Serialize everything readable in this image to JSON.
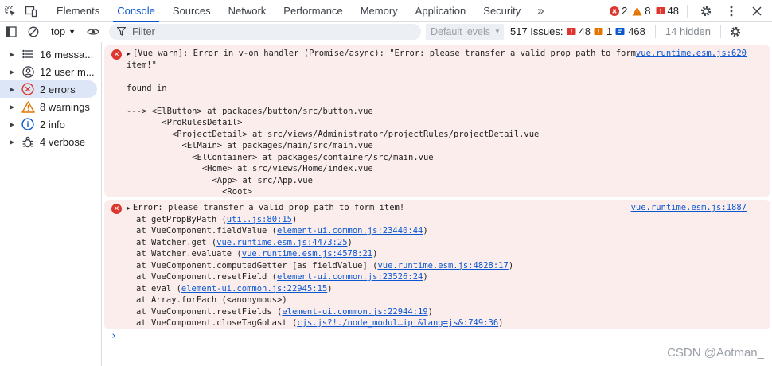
{
  "tabs": [
    "Elements",
    "Console",
    "Sources",
    "Network",
    "Performance",
    "Memory",
    "Application",
    "Security"
  ],
  "tab_counts": {
    "errors": "2",
    "warnings": "8",
    "issues": "48"
  },
  "toolbar": {
    "context": "top",
    "filter_placeholder": "Filter",
    "levels": "Default levels",
    "issues_label": "517 Issues:",
    "issues_red": "48",
    "issues_orange": "1",
    "issues_blue": "468",
    "hidden": "14 hidden"
  },
  "sidebar": [
    {
      "label": "16 messa...",
      "icon": "list-icon"
    },
    {
      "label": "12 user m...",
      "icon": "user-icon"
    },
    {
      "label": "2 errors",
      "icon": "error-icon"
    },
    {
      "label": "8 warnings",
      "icon": "warning-icon"
    },
    {
      "label": "2 info",
      "icon": "info-icon"
    },
    {
      "label": "4 verbose",
      "icon": "bug-icon"
    }
  ],
  "messages": {
    "m1": {
      "source": "vue.runtime.esm.js:620",
      "lines": [
        "[Vue warn]: Error in v-on handler (Promise/async): \"Error: please transfer a valid prop path to form",
        "item!\"",
        "",
        "found in",
        "",
        "---> <ElButton> at packages/button/src/button.vue",
        "       <ProRulesDetail>",
        "         <ProjectDetail> at src/views/Administrator/projectRules/projectDetail.vue",
        "           <ElMain> at packages/main/src/main.vue",
        "             <ElContainer> at packages/container/src/main.vue",
        "               <Home> at src/views/Home/index.vue",
        "                 <App> at src/App.vue",
        "                   <Root>"
      ]
    },
    "m2": {
      "source": "vue.runtime.esm.js:1887",
      "title": "Error: please transfer a valid prop path to form item!",
      "stack": [
        {
          "pre": "at getPropByPath (",
          "link": "util.js:80:15",
          "post": ")"
        },
        {
          "pre": "at VueComponent.fieldValue (",
          "link": "element-ui.common.js:23440:44",
          "post": ")"
        },
        {
          "pre": "at Watcher.get (",
          "link": "vue.runtime.esm.js:4473:25",
          "post": ")"
        },
        {
          "pre": "at Watcher.evaluate (",
          "link": "vue.runtime.esm.js:4578:21",
          "post": ")"
        },
        {
          "pre": "at VueComponent.computedGetter [as fieldValue] (",
          "link": "vue.runtime.esm.js:4828:17",
          "post": ")"
        },
        {
          "pre": "at VueComponent.resetField (",
          "link": "element-ui.common.js:23526:24",
          "post": ")"
        },
        {
          "pre": "at eval (",
          "link": "element-ui.common.js:22945:15",
          "post": ")"
        },
        {
          "pre": "at Array.forEach (<anonymous>)",
          "link": "",
          "post": ""
        },
        {
          "pre": "at VueComponent.resetFields (",
          "link": "element-ui.common.js:22944:19",
          "post": ")"
        },
        {
          "pre": "at VueComponent.closeTagGoLast (",
          "link": "cjs.js?!./node_modul…ipt&lang=js&:749:36",
          "post": ")"
        }
      ]
    }
  },
  "prompt": "›",
  "watermark": "CSDN @Aotman_",
  "colors": {
    "accent": "#0b57d0",
    "error": "#dc362e",
    "warning": "#e37400",
    "error_bg": "#fceded"
  }
}
